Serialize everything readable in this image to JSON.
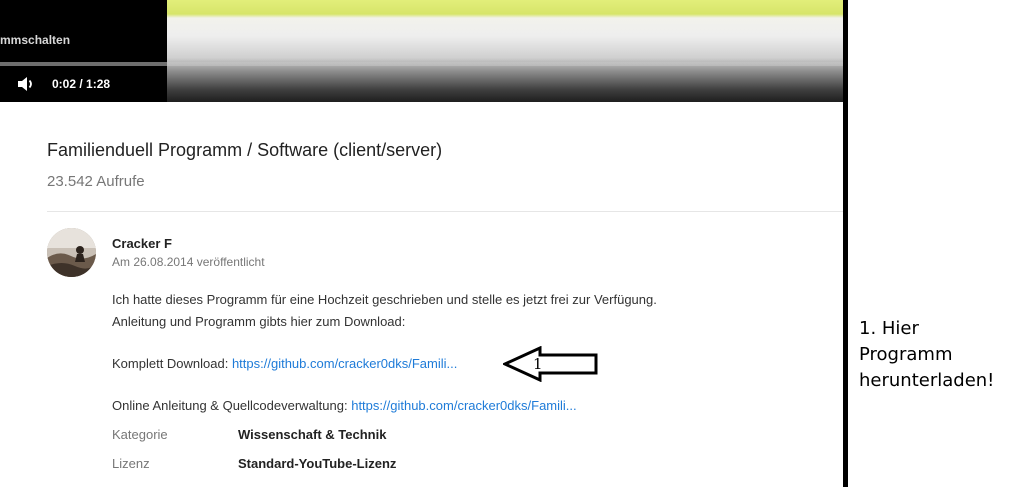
{
  "player": {
    "annotation_text": "mmschalten",
    "time": "0:02 / 1:28",
    "progress_fraction": 0.0227
  },
  "video": {
    "title": "Familienduell Programm / Software (client/server)",
    "views": "23.542 Aufrufe"
  },
  "channel": {
    "name": "Cracker F",
    "published": "Am 26.08.2014 veröffentlicht"
  },
  "description": {
    "line1": "Ich hatte dieses Programm für eine Hochzeit geschrieben und stelle es jetzt frei zur Verfügung.",
    "line2": "Anleitung und Programm gibts hier zum Download:",
    "download_label": "Komplett Download: ",
    "download_link": "https://github.com/cracker0dks/Famili...",
    "manual_label": "Online Anleitung & Quellcodeverwaltung: ",
    "manual_link": "https://github.com/cracker0dks/Famili..."
  },
  "meta": {
    "category_label": "Kategorie",
    "category_value": "Wissenschaft & Technik",
    "license_label": "Lizenz",
    "license_value": "Standard-YouTube-Lizenz"
  },
  "overlay": {
    "arrow_number": "1",
    "note": "1. Hier\nProgramm\nherunterladen!"
  },
  "icons": {
    "volume": "volume-icon",
    "arrow": "left-arrow-icon"
  },
  "colors": {
    "link": "#1e7bd8"
  }
}
